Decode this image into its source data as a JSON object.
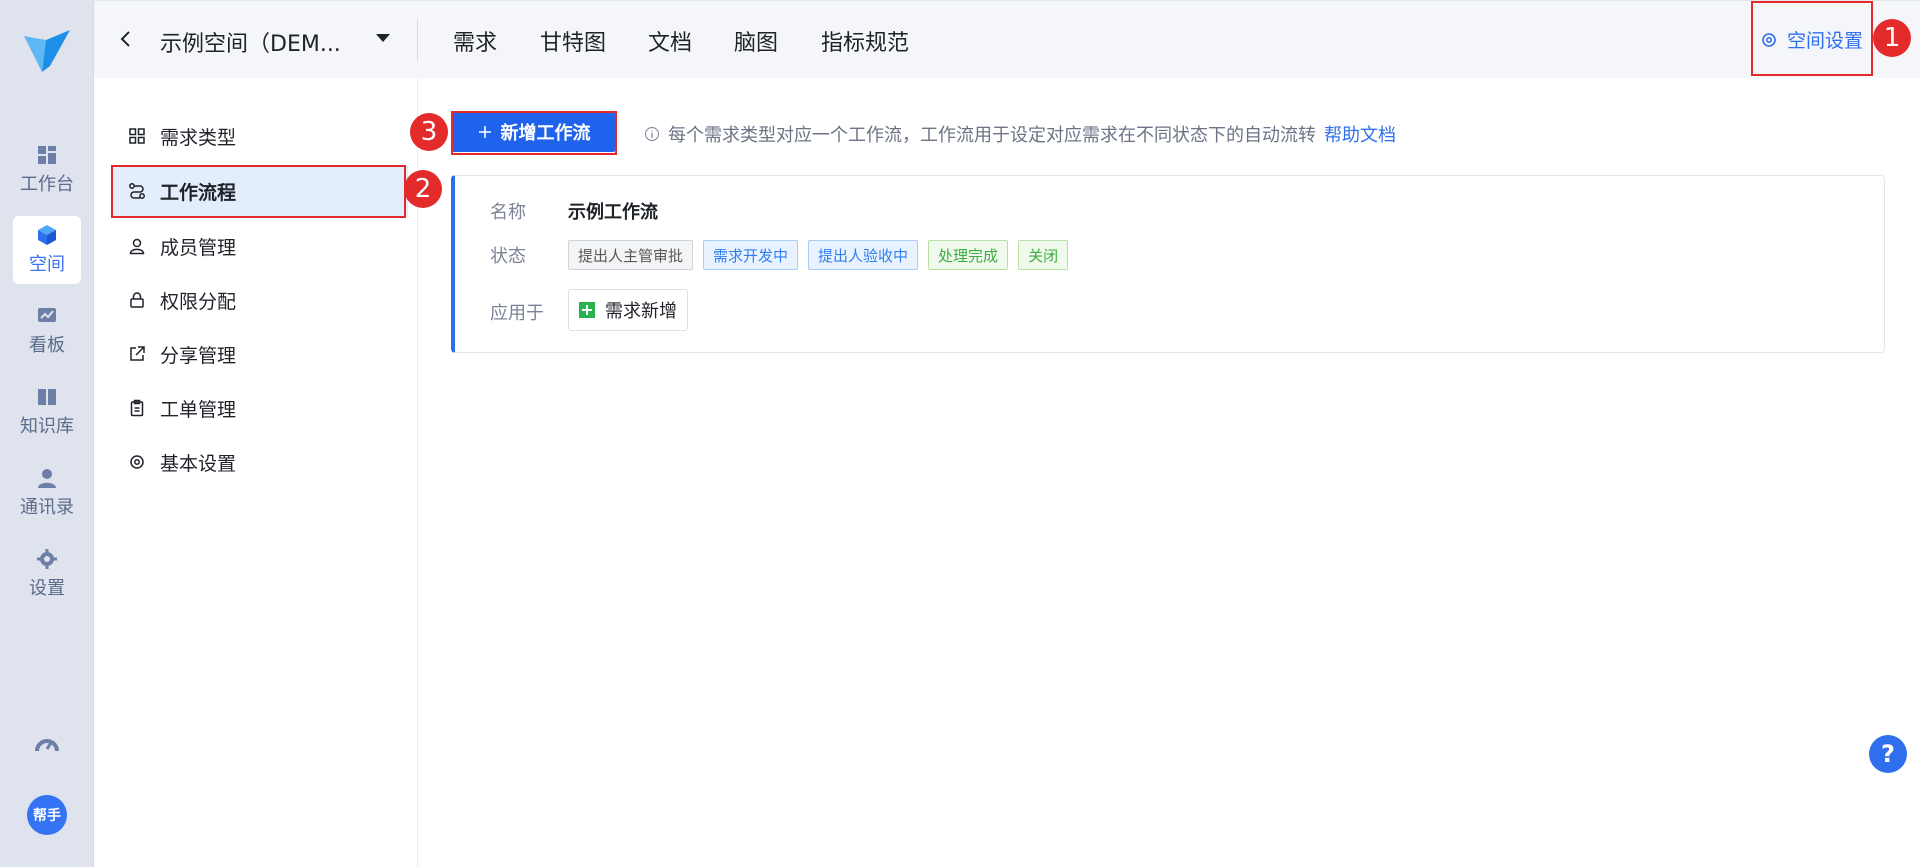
{
  "rail": {
    "items": [
      {
        "label": "工作台",
        "icon": "dashboard-icon"
      },
      {
        "label": "空间",
        "icon": "cube-icon"
      },
      {
        "label": "看板",
        "icon": "chart-board-icon"
      },
      {
        "label": "知识库",
        "icon": "book-icon"
      },
      {
        "label": "通讯录",
        "icon": "contacts-icon"
      },
      {
        "label": "设置",
        "icon": "gear-icon"
      }
    ],
    "helper_label": "帮手"
  },
  "topbar": {
    "space_name": "示例空间（DEM...",
    "nav": [
      "需求",
      "甘特图",
      "文档",
      "脑图",
      "指标规范"
    ],
    "settings_label": "空间设置"
  },
  "annotations": [
    "1",
    "2",
    "3"
  ],
  "sidemenu": {
    "items": [
      {
        "label": "需求类型",
        "icon": "grid-icon"
      },
      {
        "label": "工作流程",
        "icon": "workflow-icon"
      },
      {
        "label": "成员管理",
        "icon": "user-icon"
      },
      {
        "label": "权限分配",
        "icon": "lock-icon"
      },
      {
        "label": "分享管理",
        "icon": "share-icon"
      },
      {
        "label": "工单管理",
        "icon": "clipboard-icon"
      },
      {
        "label": "基本设置",
        "icon": "gear-icon"
      }
    ]
  },
  "content": {
    "add_button": "新增工作流",
    "hint": "每个需求类型对应一个工作流，工作流用于设定对应需求在不同状态下的自动流转",
    "help_link": "帮助文档",
    "card": {
      "name_label": "名称",
      "name_value": "示例工作流",
      "status_label": "状态",
      "statuses": [
        {
          "text": "提出人主管审批",
          "color": "#595959",
          "bg": "#f3f4f6",
          "border": "#cfd3da"
        },
        {
          "text": "需求开发中",
          "color": "#2f7ef0",
          "bg": "#e8f3ff",
          "border": "#a8cdf7"
        },
        {
          "text": "提出人验收中",
          "color": "#2f7ef0",
          "bg": "#e8f3ff",
          "border": "#a8cdf7"
        },
        {
          "text": "处理完成",
          "color": "#3dab3d",
          "bg": "#f0faec",
          "border": "#b8e2a5"
        },
        {
          "text": "关闭",
          "color": "#3dab3d",
          "bg": "#f0faec",
          "border": "#b8e2a5"
        }
      ],
      "apply_label": "应用于",
      "apply_value": "需求新增"
    }
  }
}
